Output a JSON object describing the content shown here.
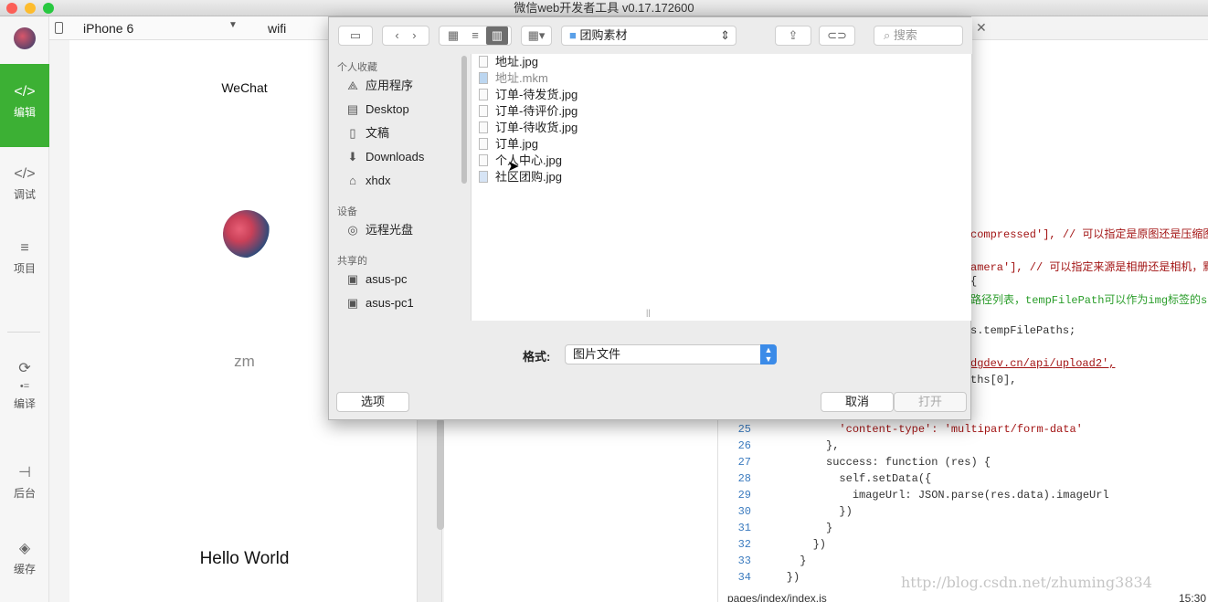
{
  "titlebar": {
    "title": "微信web开发者工具 v0.17.172600"
  },
  "sidebar": {
    "items": [
      {
        "label": "编辑",
        "icon": "code-icon"
      },
      {
        "label": "调试",
        "icon": "debug-icon"
      },
      {
        "label": "项目",
        "icon": "menu-icon"
      },
      {
        "label": "编译",
        "icon": "compile-icon"
      },
      {
        "label": "后台",
        "icon": "background-icon"
      },
      {
        "label": "缓存",
        "icon": "layers-icon"
      }
    ]
  },
  "sim_toolbar": {
    "device": "iPhone 6",
    "network": "wifi"
  },
  "simulator": {
    "title": "WeChat",
    "nickname": "zm",
    "hello": "Hello World"
  },
  "dialog": {
    "folder": "团购素材",
    "search_placeholder": "搜索",
    "sidebar": {
      "favorites_header": "个人收藏",
      "favorites": [
        "应用程序",
        "Desktop",
        "文稿",
        "Downloads",
        "xhdx"
      ],
      "devices_header": "设备",
      "devices": [
        "远程光盘"
      ],
      "shared_header": "共享的",
      "shared": [
        "asus-pc",
        "asus-pc1"
      ]
    },
    "files": [
      {
        "name": "地址.jpg",
        "dim": false
      },
      {
        "name": "地址.mkm",
        "dim": true
      },
      {
        "name": "订单-待发货.jpg",
        "dim": false
      },
      {
        "name": "订单-待评价.jpg",
        "dim": false
      },
      {
        "name": "订单-待收货.jpg",
        "dim": false
      },
      {
        "name": "订单.jpg",
        "dim": false
      },
      {
        "name": "个人中心.jpg",
        "dim": false
      },
      {
        "name": "社区团购.jpg",
        "dim": false
      }
    ],
    "format_label": "格式:",
    "format_value": "图片文件",
    "options_button": "选项",
    "cancel_button": "取消",
    "open_button": "打开"
  },
  "editor": {
    "partial_lines": [
      "compressed'], // 可以指定是原图还是压缩图",
      "amera'], // 可以指定来源是相册还是相机，默",
      "{",
      "路径列表，tempFilePath可以作为img标签的src",
      "s.tempFilePaths;",
      "dgdev.cn/api/upload2',",
      "ths[0],"
    ],
    "lines": [
      {
        "n": "25",
        "text": "            'content-type': 'multipart/form-data'"
      },
      {
        "n": "26",
        "text": "          },"
      },
      {
        "n": "27",
        "text": "          success: function (res) {"
      },
      {
        "n": "28",
        "text": "            self.setData({"
      },
      {
        "n": "29",
        "text": "              imageUrl: JSON.parse(res.data).imageUrl"
      },
      {
        "n": "30",
        "text": "            })"
      },
      {
        "n": "31",
        "text": "          }"
      },
      {
        "n": "32",
        "text": "        })"
      },
      {
        "n": "33",
        "text": "      }"
      },
      {
        "n": "34",
        "text": "    })"
      }
    ],
    "file_path": "pages/index/index.js",
    "time": "15:30"
  },
  "watermark": "http://blog.csdn.net/zhuming3834"
}
